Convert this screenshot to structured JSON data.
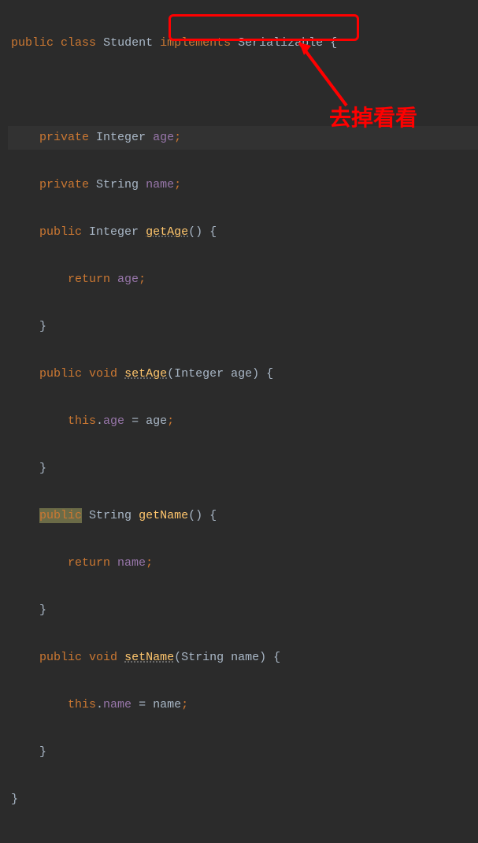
{
  "annotation": {
    "label": "去掉看看"
  },
  "code": {
    "l1_public": "public",
    "l1_class": "class",
    "l1_name": "Student",
    "l1_impl": "implements",
    "l1_ser": "Serializable",
    "l1_brace": "{",
    "l3_priv": "private",
    "l3_type": "Integer",
    "l3_field": "age",
    "l4_priv": "private",
    "l4_type": "String",
    "l4_field": "name",
    "l5_pub": "public",
    "l5_type": "Integer",
    "l5_method": "getAge",
    "l5_rest": "() {",
    "l6_ret": "return",
    "l6_field": "age",
    "l7_brace": "}",
    "l8_pub": "public",
    "l8_void": "void",
    "l8_method": "setAge",
    "l8_paren": "(Integer age) {",
    "l9_this": "this",
    "l9_dot": ".",
    "l9_field": "age",
    "l9_eq": " = age",
    "l10_brace": "}",
    "l11_pub": "public",
    "l11_type": "String",
    "l11_method": "getName",
    "l11_rest": "() {",
    "l12_ret": "return",
    "l12_field": "name",
    "l13_brace": "}",
    "l14_pub": "public",
    "l14_void": "void",
    "l14_method": "setName",
    "l14_paren": "(String name) {",
    "l15_this": "this",
    "l15_dot": ".",
    "l15_field": "name",
    "l15_eq": " = name",
    "l16_brace": "}",
    "l17_brace": "}"
  }
}
